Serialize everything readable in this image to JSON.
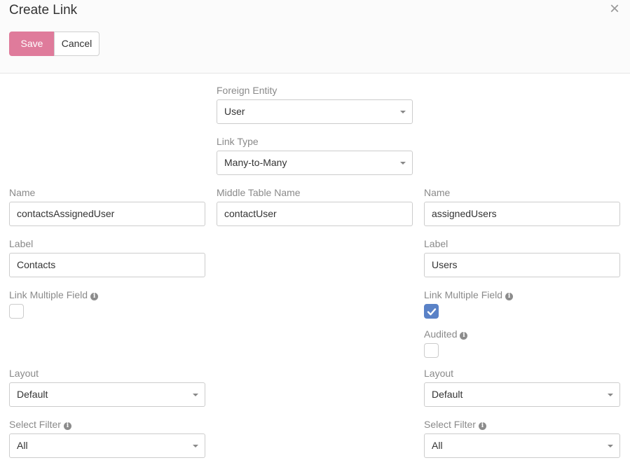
{
  "header": {
    "title": "Create Link",
    "close_glyph": "×",
    "save_label": "Save",
    "cancel_label": "Cancel"
  },
  "center": {
    "foreign_entity_label": "Foreign Entity",
    "foreign_entity_value": "User",
    "link_type_label": "Link Type",
    "link_type_value": "Many-to-Many",
    "middle_table_label": "Middle Table Name",
    "middle_table_value": "contactUser"
  },
  "left": {
    "name_label": "Name",
    "name_value": "contactsAssignedUser",
    "label_label": "Label",
    "label_value": "Contacts",
    "link_multiple_label": "Link Multiple Field",
    "link_multiple_checked": false,
    "layout_label": "Layout",
    "layout_value": "Default",
    "select_filter_label": "Select Filter",
    "select_filter_value": "All"
  },
  "right": {
    "name_label": "Name",
    "name_value": "assignedUsers",
    "label_label": "Label",
    "label_value": "Users",
    "link_multiple_label": "Link Multiple Field",
    "link_multiple_checked": true,
    "audited_label": "Audited",
    "audited_checked": false,
    "layout_label": "Layout",
    "layout_value": "Default",
    "select_filter_label": "Select Filter",
    "select_filter_value": "All"
  },
  "info_glyph": "i",
  "colors": {
    "save_button": "#df7b9b",
    "checkbox_checked": "#5a82c7"
  },
  "icons": [
    "close-icon",
    "info-icon",
    "chevron-down-icon",
    "checkmark-icon"
  ]
}
